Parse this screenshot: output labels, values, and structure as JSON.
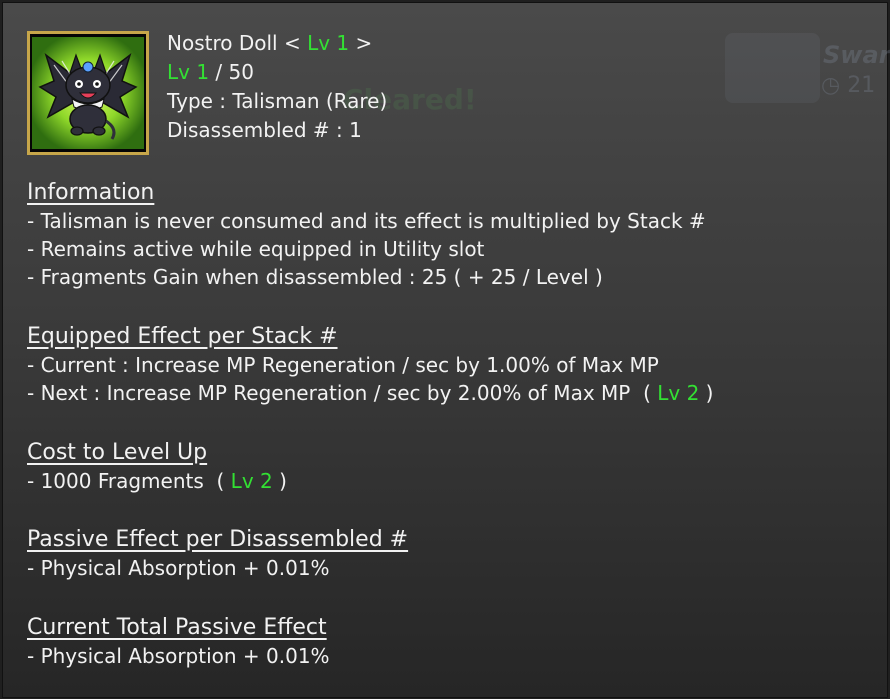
{
  "background_hud": {
    "title_fragment": "Swar",
    "timer_fragment": "21",
    "cleared_text": "Cleared!"
  },
  "item": {
    "icon": "nostro-doll-bat-icon",
    "name": "Nostro Doll",
    "name_lv_open": "<",
    "name_lv": "Lv 1",
    "name_lv_close": ">",
    "level": "Lv 1",
    "level_max": "/ 50",
    "type": "Type : Talisman (Rare)",
    "disassembled": "Disassembled # : 1"
  },
  "information": {
    "title": "Information",
    "lines": [
      "- Talisman is never consumed and its effect is multiplied by Stack #",
      "- Remains active while equipped in Utility slot",
      "- Fragments Gain when disassembled : 25 ( + 25 / Level )"
    ]
  },
  "equipped": {
    "title": "Equipped Effect per Stack #",
    "current": "- Current : Increase MP Regeneration / sec by 1.00% of Max MP",
    "next": "- Next : Increase MP Regeneration / sec by 2.00% of Max MP",
    "next_open": "(",
    "next_lv": "Lv 2",
    "next_close": ")"
  },
  "cost": {
    "title": "Cost to Level Up",
    "line": "- 1000 Fragments",
    "open": "(",
    "lv": "Lv 2",
    "close": ")"
  },
  "passive": {
    "title": "Passive Effect per Disassembled #",
    "line": "- Physical Absorption + 0.01%"
  },
  "total": {
    "title": "Current Total Passive Effect",
    "line": "- Physical Absorption + 0.01%"
  },
  "colors": {
    "level_green": "#33e033",
    "frame_gold": "#c7a64a",
    "icon_glow": "#7cd020"
  }
}
